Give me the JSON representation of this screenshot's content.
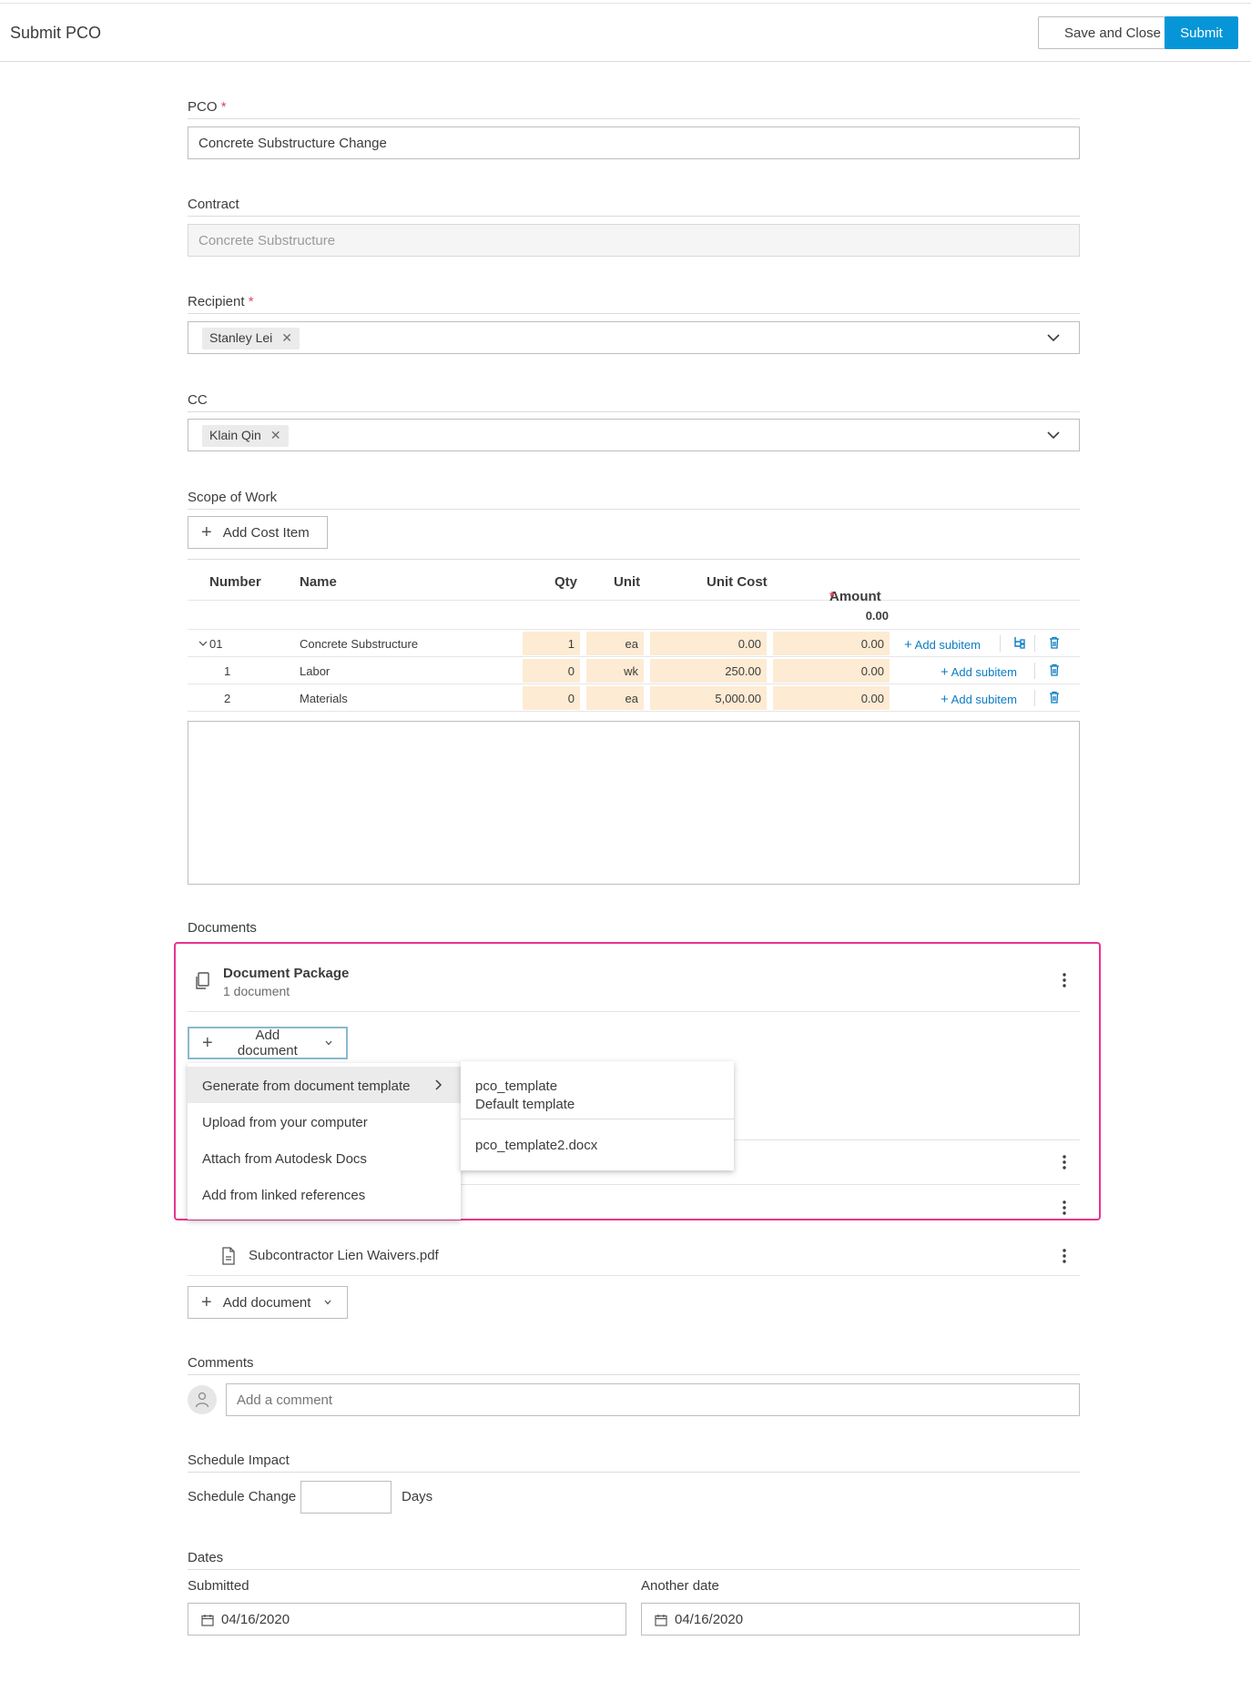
{
  "header": {
    "title": "Submit PCO",
    "save_close_label": "Save and Close",
    "submit_label": "Submit"
  },
  "pco": {
    "label": "PCO",
    "required_mark": "*",
    "value": "Concrete Substructure Change"
  },
  "contract": {
    "label": "Contract",
    "value": "Concrete Substructure"
  },
  "recipient": {
    "label": "Recipient",
    "required_mark": "*",
    "chip": "Stanley Lei"
  },
  "cc": {
    "label": "CC",
    "chip": "Klain Qin"
  },
  "scope": {
    "label": "Scope of Work",
    "add_cost_item_label": "Add Cost Item",
    "columns": {
      "number": "Number",
      "name": "Name",
      "qty": "Qty",
      "unit": "Unit",
      "unit_cost": "Unit Cost",
      "amount": "Amount"
    },
    "amount_required_mark": "*",
    "total": "0.00",
    "rows": [
      {
        "number": "01",
        "name": "Concrete Substructure",
        "qty": "1",
        "unit": "ea",
        "unit_cost": "0.00",
        "amount": "0.00",
        "action": "Add subitem"
      },
      {
        "number": "1",
        "name": "Labor",
        "qty": "0",
        "unit": "wk",
        "unit_cost": "250.00",
        "amount": "0.00",
        "action": "Add subitem"
      },
      {
        "number": "2",
        "name": "Materials",
        "qty": "0",
        "unit": "ea",
        "unit_cost": "5,000.00",
        "amount": "0.00",
        "action": "Add subitem"
      }
    ]
  },
  "documents": {
    "label": "Documents",
    "package_title": "Document Package",
    "package_count": "1 document",
    "add_document_label": "Add document",
    "menu": [
      "Generate from document template",
      "Upload from your computer",
      "Attach from Autodesk Docs",
      "Add from linked references"
    ],
    "submenu": {
      "item1_name": "pco_template",
      "item1_sub": "Default template",
      "item2_name": "pco_template2.docx"
    },
    "file_name": "Subcontractor Lien Waivers.pdf"
  },
  "comments": {
    "label": "Comments",
    "placeholder": "Add a comment"
  },
  "schedule": {
    "label": "Schedule Impact",
    "change_label": "Schedule Change",
    "unit": "Days"
  },
  "dates": {
    "label": "Dates",
    "submitted_label": "Submitted",
    "submitted_value": "04/16/2020",
    "another_label": "Another date",
    "another_value": "04/16/2020"
  },
  "colors": {
    "accent": "#0696d7",
    "highlight": "#e8338f",
    "cell_bg": "#fdebd3",
    "link": "#0b7cc4"
  }
}
